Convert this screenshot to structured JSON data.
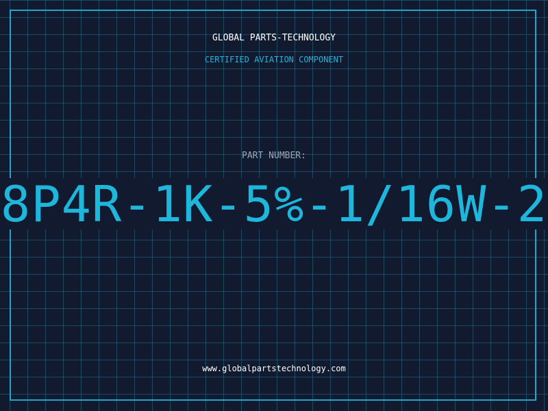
{
  "header": {
    "company": "GLOBAL PARTS-TECHNOLOGY",
    "subtitle": "CERTIFIED AVIATION COMPONENT"
  },
  "part": {
    "label": "PART NUMBER:",
    "number": "8P4R-1K-5%-1/16W-2"
  },
  "footer": {
    "url": "www.globalpartstechnology.com"
  },
  "colors": {
    "background": "#111a2e",
    "grid": "#266e8c",
    "accent": "#1fb6dc",
    "text": "#ffffff",
    "label": "#9aa8b8"
  }
}
